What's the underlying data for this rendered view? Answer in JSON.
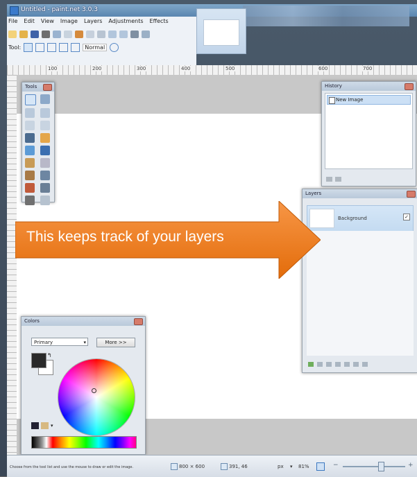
{
  "window": {
    "title": "Untitled - paint.net 3.0.3",
    "controls": [
      "–",
      "□",
      "✕"
    ]
  },
  "menu": [
    "File",
    "Edit",
    "View",
    "Image",
    "Layers",
    "Adjustments",
    "Effects"
  ],
  "toolbar": {
    "tool_label": "Tool:",
    "blend_mode": "Normal"
  },
  "ruler": {
    "ticks": [
      "100",
      "200",
      "300",
      "400",
      "500",
      "600",
      "700"
    ]
  },
  "panels": {
    "tools": {
      "title": "Tools"
    },
    "history": {
      "title": "History",
      "items": [
        "New Image"
      ]
    },
    "layers": {
      "title": "Layers",
      "items": [
        "Background"
      ]
    },
    "colors": {
      "title": "Colors",
      "mode": "Primary",
      "more_button": "More >>",
      "primary_color": "#2a2a2a",
      "secondary_color": "#ffffff"
    }
  },
  "callout": {
    "text": "This keeps track of your layers",
    "color": "#ed7d31"
  },
  "status": {
    "hint": "Choose from the tool list and use the mouse to draw or edit the image.",
    "image_size": "800 × 600",
    "cursor": "391, 46",
    "units": "px",
    "zoom": "81%"
  }
}
